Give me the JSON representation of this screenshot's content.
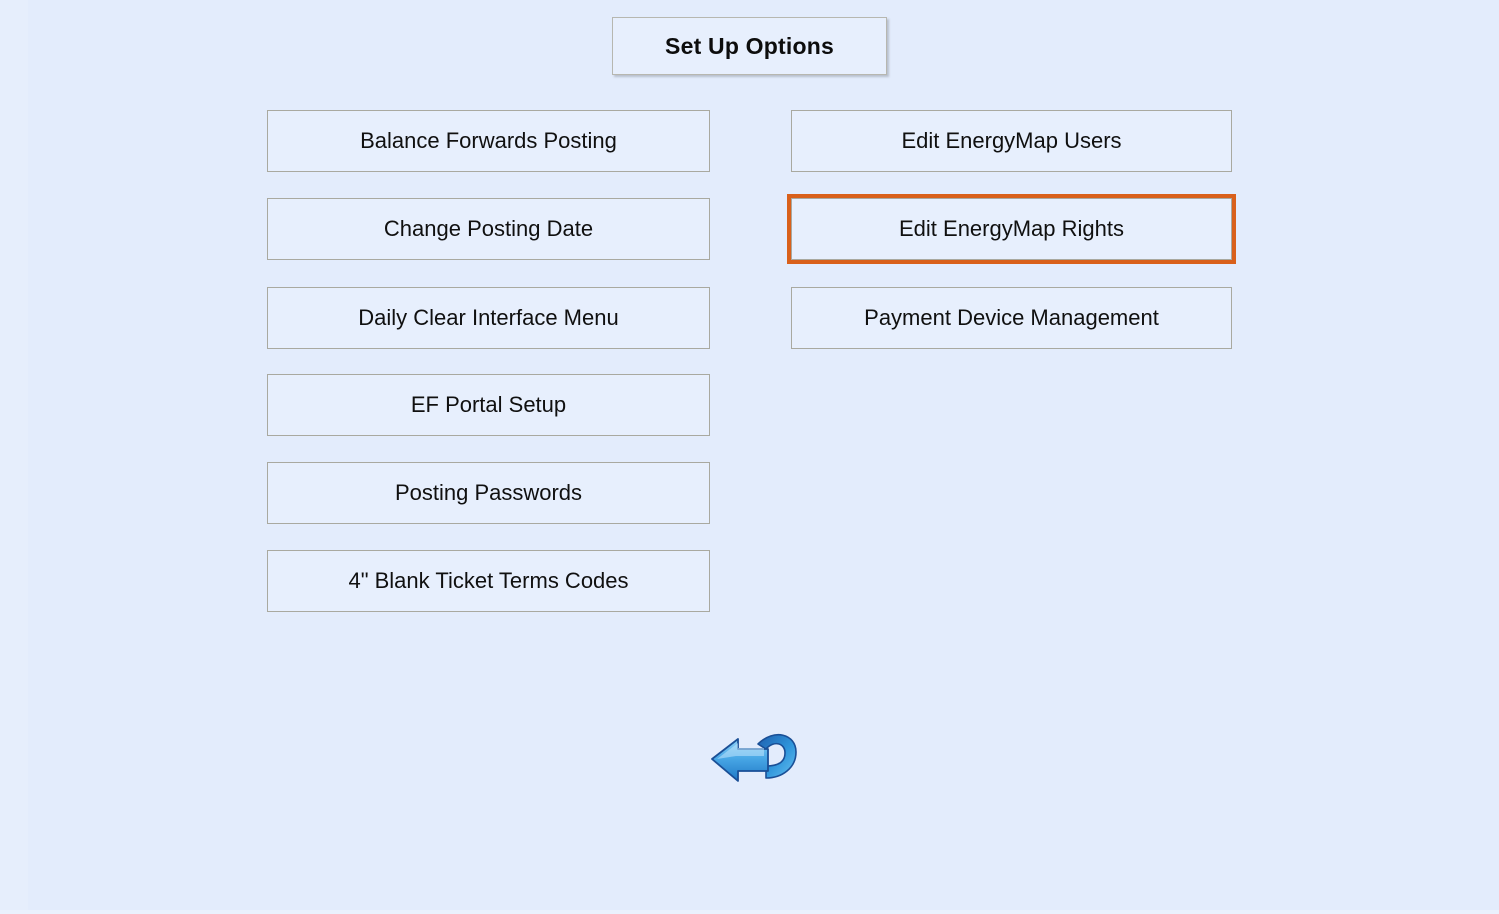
{
  "header": {
    "title": "Set Up Options"
  },
  "colors": {
    "page_background": "#e3ecfc",
    "button_fill": "#e7effd",
    "button_border": "#a9a9a0",
    "highlight_accent": "#d9601b",
    "text": "#101010",
    "arrow_blue_light": "#7fc5f2",
    "arrow_blue_mid": "#2a8ed8",
    "arrow_blue_dark": "#1352a0"
  },
  "menu": {
    "left_column": [
      {
        "label": "Balance Forwards Posting",
        "highlighted": false
      },
      {
        "label": "Change Posting Date",
        "highlighted": false
      },
      {
        "label": "Daily Clear Interface Menu",
        "highlighted": false
      },
      {
        "label": "EF Portal Setup",
        "highlighted": false
      },
      {
        "label": "Posting Passwords",
        "highlighted": false
      },
      {
        "label": "4\" Blank Ticket Terms Codes",
        "highlighted": false
      }
    ],
    "right_column": [
      {
        "label": "Edit EnergyMap Users",
        "highlighted": false
      },
      {
        "label": "Edit EnergyMap Rights",
        "highlighted": true
      },
      {
        "label": "Payment Device Management",
        "highlighted": false
      }
    ]
  },
  "footer": {
    "back_icon": "back-arrow-icon"
  }
}
